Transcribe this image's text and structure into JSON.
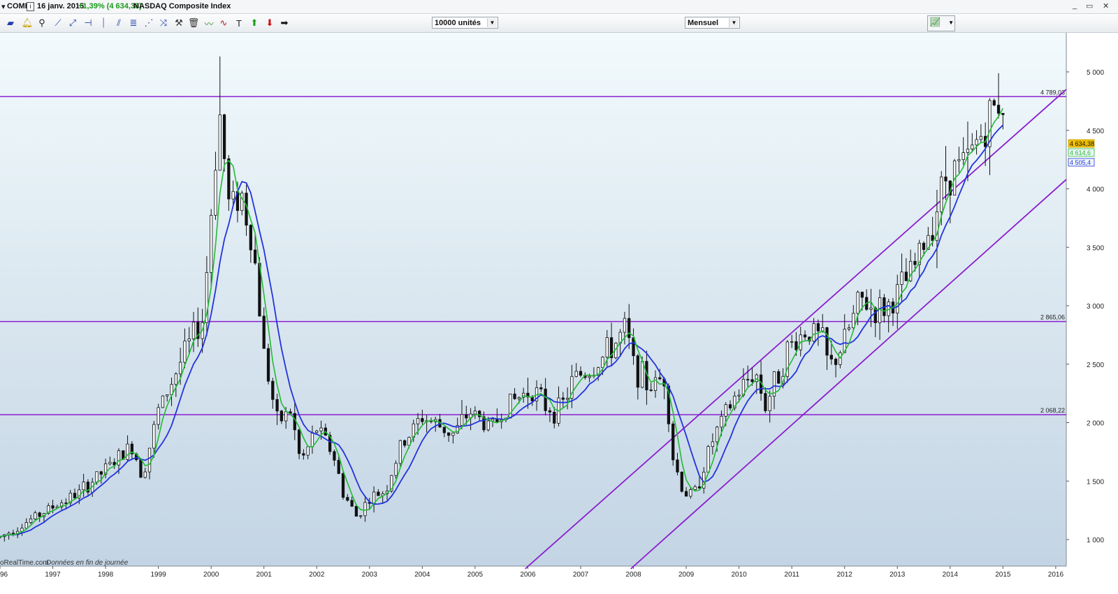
{
  "header": {
    "symbol": "COMP",
    "info_icon": "i",
    "date": "16 janv. 2015",
    "change": "+1,39% (4 634,38)",
    "name": "NASDAQ Composite Index",
    "change_color": "#1a9a1a"
  },
  "window": {
    "minimize": "_",
    "restore": "▭",
    "close": "✕"
  },
  "toolbar": {
    "tools": [
      "ruler-icon",
      "bell-icon",
      "magnifier-icon",
      "trendline-icon",
      "ray-icon",
      "horizontal-line-icon",
      "vertical-line-icon",
      "channel-icon",
      "fibonacci-icon",
      "pitchfork-icon",
      "gann-icon",
      "hammer-icon",
      "trash-icon",
      "zigzag-icon",
      "wave-icon",
      "text-icon",
      "buy-arrow-icon",
      "sell-arrow-icon",
      "next-arrow-icon"
    ],
    "units_select": "10000 unités",
    "period_select": "Mensuel"
  },
  "chart_data": {
    "type": "candlestick",
    "title": "NASDAQ Composite Index",
    "period": "Mensuel",
    "ylim": [
      750,
      5300
    ],
    "xlim": [
      1996.0,
      2016.2
    ],
    "y_ticks": [
      "5 000",
      "4 500",
      "4 000",
      "3 500",
      "3 000",
      "2 500",
      "2 000",
      "1 500",
      "1 000"
    ],
    "y_tick_values": [
      5000,
      4500,
      4000,
      3500,
      3000,
      2500,
      2000,
      1500,
      1000
    ],
    "x_ticks": [
      "96",
      "1997",
      "1998",
      "1999",
      "2000",
      "2001",
      "2002",
      "2003",
      "2004",
      "2005",
      "2006",
      "2007",
      "2008",
      "2009",
      "2010",
      "2011",
      "2012",
      "2013",
      "2014",
      "2015",
      "2016"
    ],
    "x_tick_values": [
      1996,
      1997,
      1998,
      1999,
      2000,
      2001,
      2002,
      2003,
      2004,
      2005,
      2006,
      2007,
      2008,
      2009,
      2010,
      2011,
      2012,
      2013,
      2014,
      2015,
      2016
    ],
    "horizontal_levels": [
      {
        "value": 4789.03,
        "label": "4 789,03"
      },
      {
        "value": 2865.06,
        "label": "2 865,06"
      },
      {
        "value": 2068.22,
        "label": "2 068,22"
      }
    ],
    "channel_lines": [
      {
        "from": [
          2005.95,
          750
        ],
        "to": [
          2016.2,
          4850
        ]
      },
      {
        "from": [
          2007.95,
          750
        ],
        "to": [
          2016.2,
          4080
        ]
      }
    ],
    "last_values": [
      {
        "label": "4 634,38",
        "color": "#f0c000"
      },
      {
        "label": "4 614,6",
        "color": "#22bb33"
      },
      {
        "label": "4 505,4",
        "color": "#2233dd"
      }
    ],
    "series": [
      {
        "name": "prix",
        "color": "#111111"
      },
      {
        "name": "moyenne courte",
        "color": "#22bb33"
      },
      {
        "name": "moyenne longue",
        "color": "#2233dd"
      }
    ],
    "anchors": [
      [
        1996.0,
        1020
      ],
      [
        1996.5,
        1150
      ],
      [
        1997.0,
        1280
      ],
      [
        1997.5,
        1400
      ],
      [
        1998.0,
        1600
      ],
      [
        1998.5,
        1800
      ],
      [
        1998.7,
        1550
      ],
      [
        1999.0,
        2100
      ],
      [
        1999.5,
        2600
      ],
      [
        1999.85,
        2900
      ],
      [
        2000.15,
        4700
      ],
      [
        2000.35,
        3800
      ],
      [
        2000.55,
        4000
      ],
      [
        2000.8,
        3500
      ],
      [
        2001.0,
        2600
      ],
      [
        2001.25,
        2000
      ],
      [
        2001.5,
        2100
      ],
      [
        2001.7,
        1650
      ],
      [
        2002.0,
        1950
      ],
      [
        2002.3,
        1750
      ],
      [
        2002.5,
        1400
      ],
      [
        2002.75,
        1200
      ],
      [
        2003.0,
        1350
      ],
      [
        2003.3,
        1420
      ],
      [
        2003.6,
        1800
      ],
      [
        2004.0,
        2050
      ],
      [
        2004.6,
        1900
      ],
      [
        2004.9,
        2100
      ],
      [
        2005.3,
        1950
      ],
      [
        2005.6,
        2150
      ],
      [
        2006.1,
        2300
      ],
      [
        2006.3,
        2150
      ],
      [
        2006.6,
        2100
      ],
      [
        2006.9,
        2400
      ],
      [
        2007.2,
        2450
      ],
      [
        2007.7,
        2700
      ],
      [
        2007.85,
        2800
      ],
      [
        2008.0,
        2500
      ],
      [
        2008.3,
        2300
      ],
      [
        2008.6,
        2400
      ],
      [
        2008.75,
        1700
      ],
      [
        2008.95,
        1400
      ],
      [
        2009.15,
        1380
      ],
      [
        2009.5,
        1850
      ],
      [
        2009.9,
        2200
      ],
      [
        2010.3,
        2450
      ],
      [
        2010.5,
        2150
      ],
      [
        2010.95,
        2650
      ],
      [
        2011.3,
        2800
      ],
      [
        2011.6,
        2700
      ],
      [
        2011.7,
        2450
      ],
      [
        2011.95,
        2650
      ],
      [
        2012.3,
        3050
      ],
      [
        2012.6,
        2950
      ],
      [
        2012.85,
        3000
      ],
      [
        2013.3,
        3300
      ],
      [
        2013.6,
        3650
      ],
      [
        2013.95,
        4150
      ],
      [
        2014.3,
        4200
      ],
      [
        2014.5,
        4400
      ],
      [
        2014.75,
        4600
      ],
      [
        2014.92,
        4780
      ],
      [
        2015.0,
        4634
      ]
    ]
  },
  "footer": {
    "source": "oRealTime.com",
    "note": "Données en fin de journée"
  }
}
